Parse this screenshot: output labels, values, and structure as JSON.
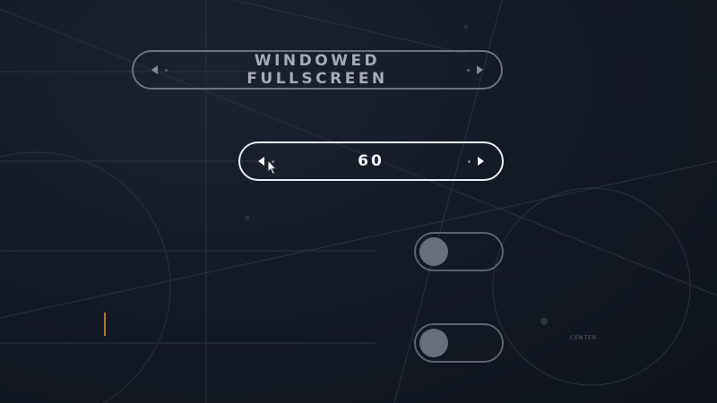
{
  "settings": {
    "display_mode": {
      "value": "WINDOWED FULLSCREEN"
    },
    "fps_limit": {
      "value": "60"
    },
    "toggles": [
      {
        "state": "off"
      },
      {
        "state": "off"
      }
    ]
  },
  "background": {
    "decor_label": "CENTER"
  },
  "colors": {
    "background": "#131821",
    "active_border": "#e9ecf1",
    "inactive_border": "#6c7280",
    "knob": "#676e7e",
    "accent_mark": "#b8742c"
  },
  "icons": {
    "left_arrow": "left-arrow-icon",
    "right_arrow": "right-arrow-icon",
    "cursor": "mouse-cursor-icon"
  }
}
